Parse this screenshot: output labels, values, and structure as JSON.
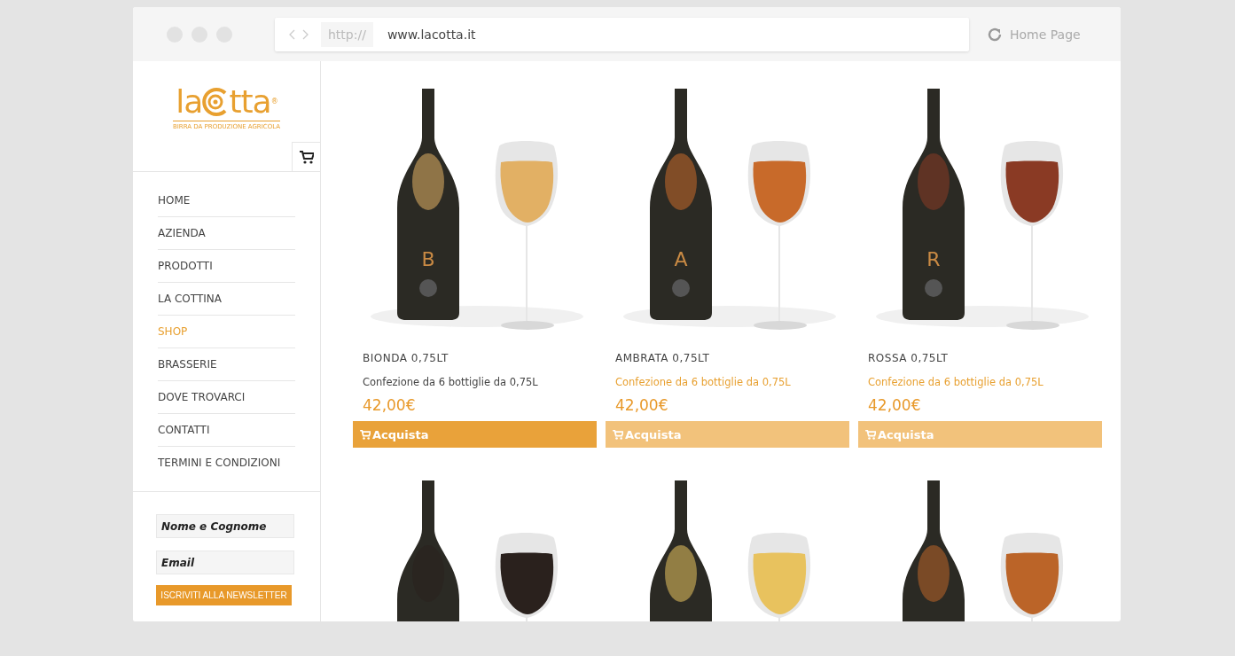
{
  "browser": {
    "scheme": "http://",
    "url": "www.lacotta.it",
    "home": "Home Page"
  },
  "sidebar": {
    "logo": "la",
    "logo_rest": "tta",
    "logo_mark": "®",
    "tagline": "BIRRA DA PRODUZIONE AGRICOLA",
    "nav": [
      {
        "label": "HOME",
        "selected": false
      },
      {
        "label": "AZIENDA",
        "selected": false
      },
      {
        "label": "PRODOTTI",
        "selected": false
      },
      {
        "label": "LA COTTINA",
        "selected": false
      },
      {
        "label": "SHOP",
        "selected": true
      },
      {
        "label": "BRASSERIE",
        "selected": false
      },
      {
        "label": "DOVE TROVARCI",
        "selected": false
      },
      {
        "label": "CONTATTI",
        "selected": false
      },
      {
        "label": "TERMINI E CONDIZIONI",
        "selected": false
      }
    ],
    "newsletter": {
      "name_placeholder": "Nome e Cognome",
      "email_placeholder": "Email",
      "button": "ISCRIVITI ALLA NEWSLETTER"
    }
  },
  "products": [
    {
      "letter": "B",
      "color": "#e2b064",
      "name": "BIONDA 0,75LT",
      "description": "Confezione da 6 bottiglie da 0,75L",
      "price": "42,00€",
      "button": "Acquista",
      "highlighted": true
    },
    {
      "letter": "A",
      "color": "#c86a2a",
      "name": "AMBRATA 0,75LT",
      "description": "Confezione da 6 bottiglie da 0,75L",
      "price": "42,00€",
      "button": "Acquista",
      "highlighted": false
    },
    {
      "letter": "R",
      "color": "#8a3a24",
      "name": "ROSSA 0,75LT",
      "description": "Confezione da 6 bottiglie da 0,75L",
      "price": "42,00€",
      "button": "Acquista",
      "highlighted": false
    }
  ],
  "products_row_2": [
    {
      "color": "#2a211d"
    },
    {
      "color": "#e8c25e"
    },
    {
      "color": "#bb6428"
    }
  ]
}
